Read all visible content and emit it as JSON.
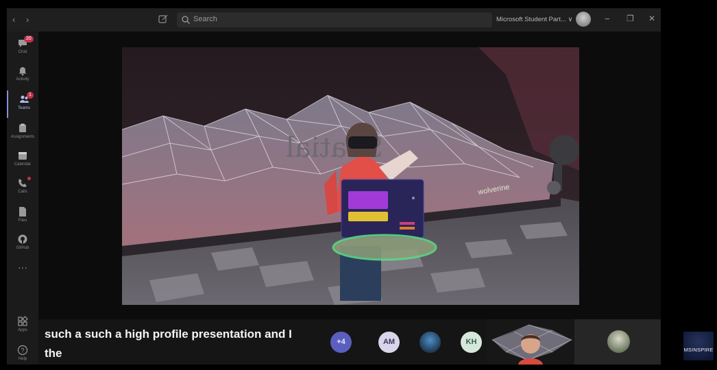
{
  "titlebar": {
    "back_icon": "chevron-left-icon",
    "forward_icon": "chevron-right-icon",
    "search_placeholder": "Search",
    "org_name": "Microsoft Student Part... ∨",
    "window_controls": {
      "more": "···",
      "minimize": "−",
      "maximize": "❐",
      "close": "✕"
    }
  },
  "rail": {
    "items": [
      {
        "label": "Chat",
        "icon": "chat-icon",
        "badge": "20"
      },
      {
        "label": "Activity",
        "icon": "bell-icon"
      },
      {
        "label": "Teams",
        "icon": "teams-icon",
        "badge": "1",
        "active": true
      },
      {
        "label": "Assignments",
        "icon": "assignments-icon"
      },
      {
        "label": "Calendar",
        "icon": "calendar-icon"
      },
      {
        "label": "Calls",
        "icon": "phone-icon",
        "dot": true
      },
      {
        "label": "Files",
        "icon": "files-icon"
      },
      {
        "label": "GitHub",
        "icon": "github-icon"
      }
    ],
    "more": "···",
    "bottom_items": [
      {
        "label": "Apps",
        "icon": "apps-icon"
      },
      {
        "label": "Help",
        "icon": "help-icon"
      }
    ]
  },
  "stage": {
    "sign_text": "Spatial",
    "brand_text": "wolverine"
  },
  "captions": {
    "line1": "such a such a high profile presentation and I",
    "line2": "the"
  },
  "participants": {
    "overflow": "+4",
    "initials": [
      "AM",
      "KH"
    ]
  },
  "logo": {
    "text": "MSINSPIRE"
  }
}
